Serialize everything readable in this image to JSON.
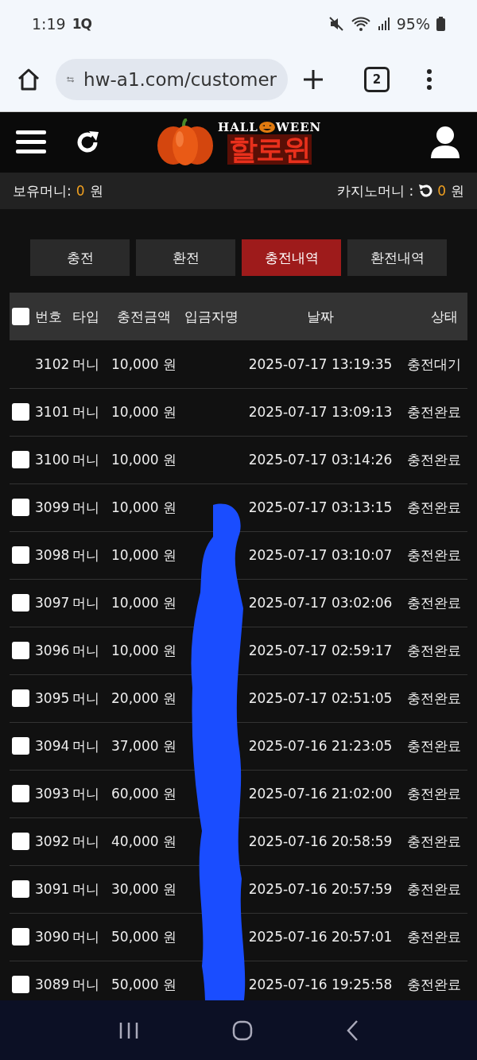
{
  "status_bar": {
    "time": "1:19",
    "notification": "1Q",
    "battery": "95%"
  },
  "browser": {
    "url": "hw-a1.com/customer",
    "tab_count": "2"
  },
  "header": {
    "logo_top_left": "HALL",
    "logo_top_right": "WEEN",
    "logo_main": "할로윈"
  },
  "money_bar": {
    "held_label": "보유머니:",
    "held_amount": "0",
    "held_unit": "원",
    "casino_label": "카지노머니 :",
    "casino_amount": "0",
    "casino_unit": "원"
  },
  "tabs": [
    {
      "label": "충전",
      "selected": false
    },
    {
      "label": "환전",
      "selected": false
    },
    {
      "label": "충전내역",
      "selected": true
    },
    {
      "label": "환전내역",
      "selected": false
    }
  ],
  "table": {
    "select_all_checked": false,
    "columns": [
      "번호",
      "타입",
      "충전금액",
      "입금자명",
      "날짜",
      "상태"
    ],
    "rows": [
      {
        "kind": "pending",
        "number": "3102",
        "type": "머니",
        "amount": "10,000 원",
        "date": "2025-07-17 13:19:35",
        "status": "충전대기"
      },
      {
        "kind": "completed",
        "checked": false,
        "number": "3101",
        "type": "머니",
        "amount": "10,000 원",
        "date": "2025-07-17 13:09:13",
        "status": "충전완료"
      },
      {
        "kind": "completed",
        "checked": false,
        "number": "3100",
        "type": "머니",
        "amount": "10,000 원",
        "date": "2025-07-17 03:14:26",
        "status": "충전완료"
      },
      {
        "kind": "completed",
        "checked": false,
        "number": "3099",
        "type": "머니",
        "amount": "10,000 원",
        "date": "2025-07-17 03:13:15",
        "status": "충전완료"
      },
      {
        "kind": "completed",
        "checked": false,
        "number": "3098",
        "type": "머니",
        "amount": "10,000 원",
        "date": "2025-07-17 03:10:07",
        "status": "충전완료"
      },
      {
        "kind": "completed",
        "checked": false,
        "number": "3097",
        "type": "머니",
        "amount": "10,000 원",
        "date": "2025-07-17 03:02:06",
        "status": "충전완료"
      },
      {
        "kind": "completed",
        "checked": false,
        "number": "3096",
        "type": "머니",
        "amount": "10,000 원",
        "date": "2025-07-17 02:59:17",
        "status": "충전완료"
      },
      {
        "kind": "completed",
        "checked": false,
        "number": "3095",
        "type": "머니",
        "amount": "20,000 원",
        "date": "2025-07-17 02:51:05",
        "status": "충전완료"
      },
      {
        "kind": "completed",
        "checked": false,
        "number": "3094",
        "type": "머니",
        "amount": "37,000 원",
        "date": "2025-07-16 21:23:05",
        "status": "충전완료"
      },
      {
        "kind": "completed",
        "checked": false,
        "number": "3093",
        "type": "머니",
        "amount": "60,000 원",
        "date": "2025-07-16 21:02:00",
        "status": "충전완료"
      },
      {
        "kind": "completed",
        "checked": false,
        "number": "3092",
        "type": "머니",
        "amount": "40,000 원",
        "date": "2025-07-16 20:58:59",
        "status": "충전완료"
      },
      {
        "kind": "completed",
        "checked": false,
        "number": "3091",
        "type": "머니",
        "amount": "30,000 원",
        "date": "2025-07-16 20:57:59",
        "status": "충전완료"
      },
      {
        "kind": "completed",
        "checked": false,
        "number": "3090",
        "type": "머니",
        "amount": "50,000 원",
        "date": "2025-07-16 20:57:01",
        "status": "충전완료"
      },
      {
        "kind": "completed",
        "checked": false,
        "number": "3089",
        "type": "머니",
        "amount": "50,000 원",
        "date": "2025-07-16 19:25:58",
        "status": "충전완료"
      }
    ]
  }
}
